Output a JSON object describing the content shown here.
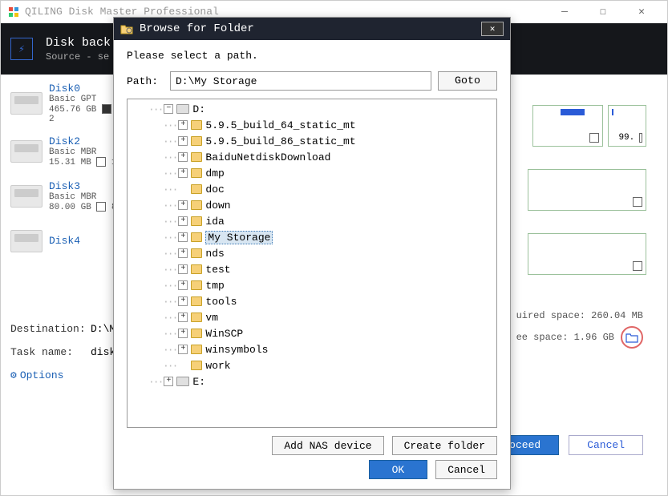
{
  "app_title": "QILING Disk Master Professional",
  "header": {
    "title": "Disk back",
    "subtitle": "Source - se"
  },
  "disks": [
    {
      "name": "Disk0",
      "type": "Basic GPT",
      "size": "465.76 GB",
      "extra": "2"
    },
    {
      "name": "Disk2",
      "type": "Basic MBR",
      "size": "15.31 MB",
      "extra": "1"
    },
    {
      "name": "Disk3",
      "type": "Basic MBR",
      "size": "80.00 GB",
      "extra": "8"
    },
    {
      "name": "Disk4",
      "type": "",
      "size": "",
      "extra": ""
    }
  ],
  "right_pct": "99.",
  "destination_label": "Destination:",
  "destination_value": "D:\\My",
  "taskname_label": "Task name:",
  "taskname_value": "disk",
  "options_label": "Options",
  "required_space": "uired space: 260.04 MB",
  "free_space": "ee space: 1.96 GB",
  "proceed": "Proceed",
  "cancel": "Cancel",
  "modal": {
    "title": "Browse for Folder",
    "prompt": "Please select a path.",
    "path_label": "Path:",
    "path_value": "D:\\My Storage",
    "goto": "Goto",
    "add_nas": "Add NAS device",
    "create_folder": "Create folder",
    "ok": "OK",
    "cancel": "Cancel",
    "tree": {
      "d_label": "D:",
      "e_label": "E:",
      "folders": [
        "5.9.5_build_64_static_mt",
        "5.9.5_build_86_static_mt",
        "BaiduNetdiskDownload",
        "dmp",
        "doc",
        "down",
        "ida",
        "My Storage",
        "nds",
        "test",
        "tmp",
        "tools",
        "vm",
        "WinSCP",
        "winsymbols",
        "work"
      ],
      "selected_index": 7
    }
  }
}
